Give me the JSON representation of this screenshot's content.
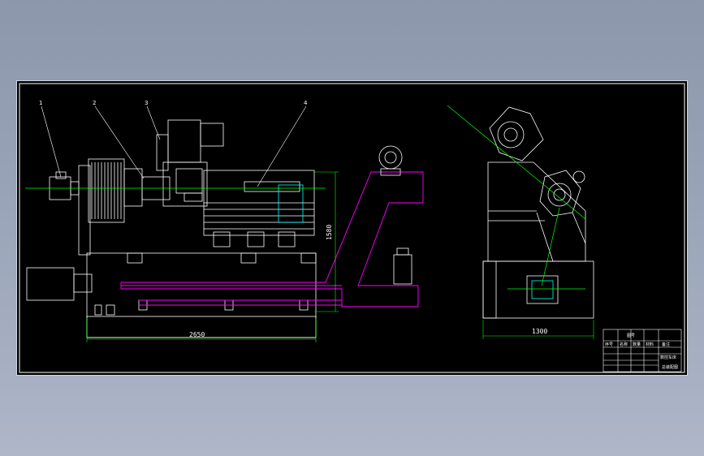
{
  "drawing": {
    "part_labels": [
      "1",
      "2",
      "3",
      "4"
    ],
    "dimensions": {
      "overall_length": "2650",
      "height": "1580",
      "width": "1300"
    }
  },
  "title_block": {
    "stamp": "图号",
    "title": "数控车床",
    "sub": "总装配图",
    "rows": [
      "序号",
      "名称",
      "数量",
      "材料",
      "备注"
    ]
  },
  "colors": {
    "background": "#8c97ab",
    "sheet": "#000000",
    "outline": "#ffffff",
    "center_line": "#00ff00",
    "chip_conveyor": "#ff00ff",
    "part_highlight": "#00ffff"
  }
}
